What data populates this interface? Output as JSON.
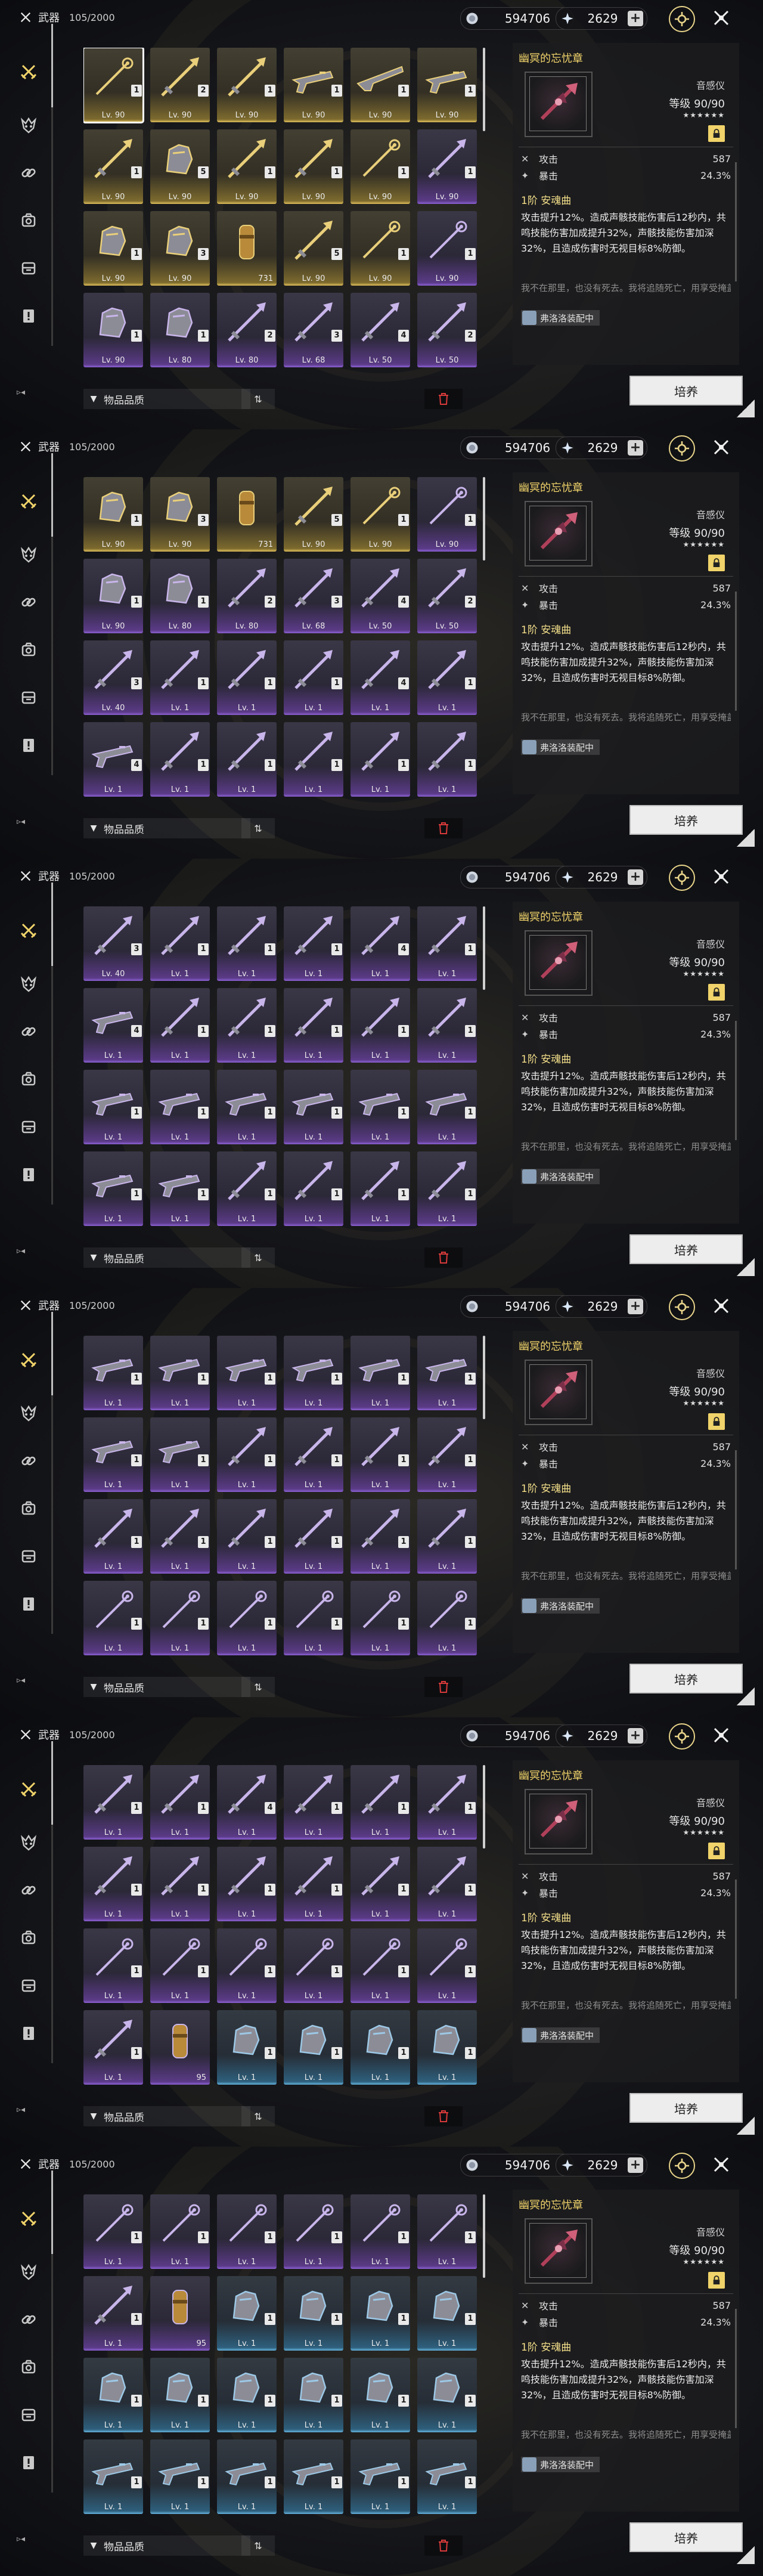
{
  "header": {
    "category": "武器",
    "count": "105/2000",
    "currency_gold": "594706",
    "currency_star": "2629",
    "plus": "+"
  },
  "filter": {
    "label": "物品品质"
  },
  "train_button": "培养",
  "detail": {
    "name": "幽冥的忘忧章",
    "type": "音感仪",
    "level": "等级 90/90",
    "stars": "★★★★★★",
    "stats": [
      {
        "name": "攻击",
        "value": "587"
      },
      {
        "name": "暴击",
        "value": "24.3%"
      }
    ],
    "skill_title": "1阶 安魂曲",
    "skill_text": "攻击提升12%。造成声骸技能伤害后12秒内，共鸣技能伤害加成提升32%，声骸技能伤害加深32%，且造成伤害时无视目标8%防御。",
    "flavor": "我不在那里，也没有死去。我将追随死亡，用享受掩盖恐惧，以未来换…",
    "equipped_by": "弗洛洛装配中"
  },
  "colors": {
    "accent": "#f0d36a",
    "rarity5": "#e2c15b",
    "rarity4": "#8d62d6",
    "rarity3": "#66b4e0"
  },
  "screens": [
    {
      "offset": 0,
      "selected_index": 0,
      "cards": [
        {
          "r": "gold",
          "lv": "Lv. 90",
          "rank": "1",
          "kind": "staff"
        },
        {
          "r": "gold",
          "lv": "Lv. 90",
          "rank": "2",
          "kind": "blade"
        },
        {
          "r": "gold",
          "lv": "Lv. 90",
          "rank": "1",
          "kind": "blade"
        },
        {
          "r": "gold",
          "lv": "Lv. 90",
          "rank": "1",
          "kind": "gun"
        },
        {
          "r": "gold",
          "lv": "Lv. 90",
          "rank": "1",
          "kind": "rifle"
        },
        {
          "r": "gold",
          "lv": "Lv. 90",
          "rank": "1",
          "kind": "gun"
        },
        {
          "r": "gold",
          "lv": "Lv. 90",
          "rank": "1",
          "kind": "blade"
        },
        {
          "r": "gold",
          "lv": "Lv. 90",
          "rank": "5",
          "kind": "gauntlet"
        },
        {
          "r": "gold",
          "lv": "Lv. 90",
          "rank": "1",
          "kind": "blade"
        },
        {
          "r": "gold",
          "lv": "Lv. 90",
          "rank": "1",
          "kind": "blade"
        },
        {
          "r": "gold",
          "lv": "Lv. 90",
          "rank": "1",
          "kind": "staff"
        },
        {
          "r": "purple",
          "lv": "Lv. 90",
          "rank": "1",
          "kind": "blade"
        },
        {
          "r": "gold",
          "lv": "Lv. 90",
          "rank": "1",
          "kind": "gauntlet"
        },
        {
          "r": "gold",
          "lv": "Lv. 90",
          "rank": "3",
          "kind": "gauntlet"
        },
        {
          "r": "gold",
          "stack": "731",
          "kind": "item"
        },
        {
          "r": "gold",
          "lv": "Lv. 90",
          "rank": "5",
          "kind": "blade"
        },
        {
          "r": "gold",
          "lv": "Lv. 90",
          "rank": "1",
          "kind": "staff"
        },
        {
          "r": "purple",
          "lv": "Lv. 90",
          "rank": "1",
          "kind": "staff"
        },
        {
          "r": "purple",
          "lv": "Lv. 90",
          "rank": "1",
          "kind": "gauntlet"
        },
        {
          "r": "purple",
          "lv": "Lv. 80",
          "rank": "1",
          "kind": "gauntlet"
        },
        {
          "r": "purple",
          "lv": "Lv. 80",
          "rank": "2",
          "kind": "blade"
        },
        {
          "r": "purple",
          "lv": "Lv. 68",
          "rank": "3",
          "kind": "blade"
        },
        {
          "r": "purple",
          "lv": "Lv. 50",
          "rank": "4",
          "kind": "blade"
        },
        {
          "r": "purple",
          "lv": "Lv. 50",
          "rank": "2",
          "kind": "blade"
        }
      ]
    },
    {
      "offset": 0,
      "selected_index": -1,
      "cards": [
        {
          "r": "gold",
          "lv": "Lv. 90",
          "rank": "1",
          "kind": "gauntlet"
        },
        {
          "r": "gold",
          "lv": "Lv. 90",
          "rank": "3",
          "kind": "gauntlet"
        },
        {
          "r": "gold",
          "stack": "731",
          "kind": "item"
        },
        {
          "r": "gold",
          "lv": "Lv. 90",
          "rank": "5",
          "kind": "blade"
        },
        {
          "r": "gold",
          "lv": "Lv. 90",
          "rank": "1",
          "kind": "staff"
        },
        {
          "r": "purple",
          "lv": "Lv. 90",
          "rank": "1",
          "kind": "staff"
        },
        {
          "r": "purple",
          "lv": "Lv. 90",
          "rank": "1",
          "kind": "gauntlet"
        },
        {
          "r": "purple",
          "lv": "Lv. 80",
          "rank": "1",
          "kind": "gauntlet"
        },
        {
          "r": "purple",
          "lv": "Lv. 80",
          "rank": "2",
          "kind": "blade"
        },
        {
          "r": "purple",
          "lv": "Lv. 68",
          "rank": "3",
          "kind": "blade"
        },
        {
          "r": "purple",
          "lv": "Lv. 50",
          "rank": "4",
          "kind": "blade"
        },
        {
          "r": "purple",
          "lv": "Lv. 50",
          "rank": "2",
          "kind": "blade"
        },
        {
          "r": "purple",
          "lv": "Lv. 40",
          "rank": "3",
          "kind": "blade"
        },
        {
          "r": "purple",
          "lv": "Lv. 1",
          "rank": "1",
          "kind": "blade"
        },
        {
          "r": "purple",
          "lv": "Lv. 1",
          "rank": "1",
          "kind": "blade"
        },
        {
          "r": "purple",
          "lv": "Lv. 1",
          "rank": "1",
          "kind": "blade"
        },
        {
          "r": "purple",
          "lv": "Lv. 1",
          "rank": "4",
          "kind": "blade"
        },
        {
          "r": "purple",
          "lv": "Lv. 1",
          "rank": "1",
          "kind": "blade"
        },
        {
          "r": "purple",
          "lv": "Lv. 1",
          "rank": "4",
          "kind": "gun"
        },
        {
          "r": "purple",
          "lv": "Lv. 1",
          "rank": "1",
          "kind": "blade"
        },
        {
          "r": "purple",
          "lv": "Lv. 1",
          "rank": "1",
          "kind": "blade"
        },
        {
          "r": "purple",
          "lv": "Lv. 1",
          "rank": "1",
          "kind": "blade"
        },
        {
          "r": "purple",
          "lv": "Lv. 1",
          "rank": "1",
          "kind": "blade"
        },
        {
          "r": "purple",
          "lv": "Lv. 1",
          "rank": "1",
          "kind": "blade"
        }
      ]
    },
    {
      "offset": 0,
      "selected_index": -1,
      "cards": [
        {
          "r": "purple",
          "lv": "Lv. 40",
          "rank": "3",
          "kind": "blade"
        },
        {
          "r": "purple",
          "lv": "Lv. 1",
          "rank": "1",
          "kind": "blade"
        },
        {
          "r": "purple",
          "lv": "Lv. 1",
          "rank": "1",
          "kind": "blade"
        },
        {
          "r": "purple",
          "lv": "Lv. 1",
          "rank": "1",
          "kind": "blade"
        },
        {
          "r": "purple",
          "lv": "Lv. 1",
          "rank": "4",
          "kind": "blade"
        },
        {
          "r": "purple",
          "lv": "Lv. 1",
          "rank": "1",
          "kind": "blade"
        },
        {
          "r": "purple",
          "lv": "Lv. 1",
          "rank": "4",
          "kind": "gun"
        },
        {
          "r": "purple",
          "lv": "Lv. 1",
          "rank": "1",
          "kind": "blade"
        },
        {
          "r": "purple",
          "lv": "Lv. 1",
          "rank": "1",
          "kind": "blade"
        },
        {
          "r": "purple",
          "lv": "Lv. 1",
          "rank": "1",
          "kind": "blade"
        },
        {
          "r": "purple",
          "lv": "Lv. 1",
          "rank": "1",
          "kind": "blade"
        },
        {
          "r": "purple",
          "lv": "Lv. 1",
          "rank": "1",
          "kind": "blade"
        },
        {
          "r": "purple",
          "lv": "Lv. 1",
          "rank": "1",
          "kind": "gun"
        },
        {
          "r": "purple",
          "lv": "Lv. 1",
          "rank": "1",
          "kind": "gun"
        },
        {
          "r": "purple",
          "lv": "Lv. 1",
          "rank": "1",
          "kind": "gun"
        },
        {
          "r": "purple",
          "lv": "Lv. 1",
          "rank": "1",
          "kind": "gun"
        },
        {
          "r": "purple",
          "lv": "Lv. 1",
          "rank": "1",
          "kind": "gun"
        },
        {
          "r": "purple",
          "lv": "Lv. 1",
          "rank": "1",
          "kind": "gun"
        },
        {
          "r": "purple",
          "lv": "Lv. 1",
          "rank": "1",
          "kind": "gun"
        },
        {
          "r": "purple",
          "lv": "Lv. 1",
          "rank": "1",
          "kind": "gun"
        },
        {
          "r": "purple",
          "lv": "Lv. 1",
          "rank": "1",
          "kind": "blade"
        },
        {
          "r": "purple",
          "lv": "Lv. 1",
          "rank": "1",
          "kind": "blade"
        },
        {
          "r": "purple",
          "lv": "Lv. 1",
          "rank": "1",
          "kind": "blade"
        },
        {
          "r": "purple",
          "lv": "Lv. 1",
          "rank": "1",
          "kind": "blade"
        }
      ]
    },
    {
      "offset": 0,
      "selected_index": -1,
      "cards": [
        {
          "r": "purple",
          "lv": "Lv. 1",
          "rank": "1",
          "kind": "gun"
        },
        {
          "r": "purple",
          "lv": "Lv. 1",
          "rank": "1",
          "kind": "gun"
        },
        {
          "r": "purple",
          "lv": "Lv. 1",
          "rank": "1",
          "kind": "gun"
        },
        {
          "r": "purple",
          "lv": "Lv. 1",
          "rank": "1",
          "kind": "gun"
        },
        {
          "r": "purple",
          "lv": "Lv. 1",
          "rank": "1",
          "kind": "gun"
        },
        {
          "r": "purple",
          "lv": "Lv. 1",
          "rank": "1",
          "kind": "gun"
        },
        {
          "r": "purple",
          "lv": "Lv. 1",
          "rank": "1",
          "kind": "gun"
        },
        {
          "r": "purple",
          "lv": "Lv. 1",
          "rank": "1",
          "kind": "gun"
        },
        {
          "r": "purple",
          "lv": "Lv. 1",
          "rank": "1",
          "kind": "blade"
        },
        {
          "r": "purple",
          "lv": "Lv. 1",
          "rank": "1",
          "kind": "blade"
        },
        {
          "r": "purple",
          "lv": "Lv. 1",
          "rank": "1",
          "kind": "blade"
        },
        {
          "r": "purple",
          "lv": "Lv. 1",
          "rank": "1",
          "kind": "blade"
        },
        {
          "r": "purple",
          "lv": "Lv. 1",
          "rank": "1",
          "kind": "blade"
        },
        {
          "r": "purple",
          "lv": "Lv. 1",
          "rank": "1",
          "kind": "blade"
        },
        {
          "r": "purple",
          "lv": "Lv. 1",
          "rank": "1",
          "kind": "blade"
        },
        {
          "r": "purple",
          "lv": "Lv. 1",
          "rank": "1",
          "kind": "blade"
        },
        {
          "r": "purple",
          "lv": "Lv. 1",
          "rank": "1",
          "kind": "blade"
        },
        {
          "r": "purple",
          "lv": "Lv. 1",
          "rank": "1",
          "kind": "blade"
        },
        {
          "r": "purple",
          "lv": "Lv. 1",
          "rank": "1",
          "kind": "staff"
        },
        {
          "r": "purple",
          "lv": "Lv. 1",
          "rank": "1",
          "kind": "staff"
        },
        {
          "r": "purple",
          "lv": "Lv. 1",
          "rank": "1",
          "kind": "staff"
        },
        {
          "r": "purple",
          "lv": "Lv. 1",
          "rank": "1",
          "kind": "staff"
        },
        {
          "r": "purple",
          "lv": "Lv. 1",
          "rank": "1",
          "kind": "staff"
        },
        {
          "r": "purple",
          "lv": "Lv. 1",
          "rank": "1",
          "kind": "staff"
        }
      ]
    },
    {
      "offset": 0,
      "selected_index": -1,
      "cards": [
        {
          "r": "purple",
          "lv": "Lv. 1",
          "rank": "1",
          "kind": "blade"
        },
        {
          "r": "purple",
          "lv": "Lv. 1",
          "rank": "1",
          "kind": "blade"
        },
        {
          "r": "purple",
          "lv": "Lv. 1",
          "rank": "4",
          "kind": "blade"
        },
        {
          "r": "purple",
          "lv": "Lv. 1",
          "rank": "1",
          "kind": "blade"
        },
        {
          "r": "purple",
          "lv": "Lv. 1",
          "rank": "1",
          "kind": "blade"
        },
        {
          "r": "purple",
          "lv": "Lv. 1",
          "rank": "1",
          "kind": "blade"
        },
        {
          "r": "purple",
          "lv": "Lv. 1",
          "rank": "1",
          "kind": "blade"
        },
        {
          "r": "purple",
          "lv": "Lv. 1",
          "rank": "1",
          "kind": "blade"
        },
        {
          "r": "purple",
          "lv": "Lv. 1",
          "rank": "1",
          "kind": "blade"
        },
        {
          "r": "purple",
          "lv": "Lv. 1",
          "rank": "1",
          "kind": "blade"
        },
        {
          "r": "purple",
          "lv": "Lv. 1",
          "rank": "1",
          "kind": "blade"
        },
        {
          "r": "purple",
          "lv": "Lv. 1",
          "rank": "1",
          "kind": "blade"
        },
        {
          "r": "purple",
          "lv": "Lv. 1",
          "rank": "1",
          "kind": "staff"
        },
        {
          "r": "purple",
          "lv": "Lv. 1",
          "rank": "1",
          "kind": "staff"
        },
        {
          "r": "purple",
          "lv": "Lv. 1",
          "rank": "1",
          "kind": "staff"
        },
        {
          "r": "purple",
          "lv": "Lv. 1",
          "rank": "1",
          "kind": "staff"
        },
        {
          "r": "purple",
          "lv": "Lv. 1",
          "rank": "1",
          "kind": "staff"
        },
        {
          "r": "purple",
          "lv": "Lv. 1",
          "rank": "1",
          "kind": "staff"
        },
        {
          "r": "purple",
          "lv": "Lv. 1",
          "rank": "1",
          "kind": "blade"
        },
        {
          "r": "purple",
          "stack": "95",
          "kind": "item"
        },
        {
          "r": "blue",
          "lv": "Lv. 1",
          "rank": "1",
          "kind": "gauntlet"
        },
        {
          "r": "blue",
          "lv": "Lv. 1",
          "rank": "1",
          "kind": "gauntlet"
        },
        {
          "r": "blue",
          "lv": "Lv. 1",
          "rank": "1",
          "kind": "gauntlet"
        },
        {
          "r": "blue",
          "lv": "Lv. 1",
          "rank": "1",
          "kind": "gauntlet"
        }
      ]
    },
    {
      "offset": 0,
      "selected_index": -1,
      "cards": [
        {
          "r": "purple",
          "lv": "Lv. 1",
          "rank": "1",
          "kind": "staff"
        },
        {
          "r": "purple",
          "lv": "Lv. 1",
          "rank": "1",
          "kind": "staff"
        },
        {
          "r": "purple",
          "lv": "Lv. 1",
          "rank": "1",
          "kind": "staff"
        },
        {
          "r": "purple",
          "lv": "Lv. 1",
          "rank": "1",
          "kind": "staff"
        },
        {
          "r": "purple",
          "lv": "Lv. 1",
          "rank": "1",
          "kind": "staff"
        },
        {
          "r": "purple",
          "lv": "Lv. 1",
          "rank": "1",
          "kind": "staff"
        },
        {
          "r": "purple",
          "lv": "Lv. 1",
          "rank": "1",
          "kind": "blade"
        },
        {
          "r": "purple",
          "stack": "95",
          "kind": "item"
        },
        {
          "r": "blue",
          "lv": "Lv. 1",
          "rank": "1",
          "kind": "gauntlet"
        },
        {
          "r": "blue",
          "lv": "Lv. 1",
          "rank": "1",
          "kind": "gauntlet"
        },
        {
          "r": "blue",
          "lv": "Lv. 1",
          "rank": "1",
          "kind": "gauntlet"
        },
        {
          "r": "blue",
          "lv": "Lv. 1",
          "rank": "1",
          "kind": "gauntlet"
        },
        {
          "r": "blue",
          "lv": "Lv. 1",
          "rank": "1",
          "kind": "gauntlet"
        },
        {
          "r": "blue",
          "lv": "Lv. 1",
          "rank": "1",
          "kind": "gauntlet"
        },
        {
          "r": "blue",
          "lv": "Lv. 1",
          "rank": "1",
          "kind": "gauntlet"
        },
        {
          "r": "blue",
          "lv": "Lv. 1",
          "rank": "1",
          "kind": "gauntlet"
        },
        {
          "r": "blue",
          "lv": "Lv. 1",
          "rank": "1",
          "kind": "gauntlet"
        },
        {
          "r": "blue",
          "lv": "Lv. 1",
          "rank": "1",
          "kind": "gauntlet"
        },
        {
          "r": "blue",
          "lv": "Lv. 1",
          "rank": "1",
          "kind": "gun"
        },
        {
          "r": "blue",
          "lv": "Lv. 1",
          "rank": "1",
          "kind": "gun"
        },
        {
          "r": "blue",
          "lv": "Lv. 1",
          "rank": "1",
          "kind": "gun"
        },
        {
          "r": "blue",
          "lv": "Lv. 1",
          "rank": "1",
          "kind": "gun"
        },
        {
          "r": "blue",
          "lv": "Lv. 1",
          "rank": "1",
          "kind": "gun"
        },
        {
          "r": "blue",
          "lv": "Lv. 1",
          "rank": "1",
          "kind": "gun"
        }
      ]
    }
  ]
}
